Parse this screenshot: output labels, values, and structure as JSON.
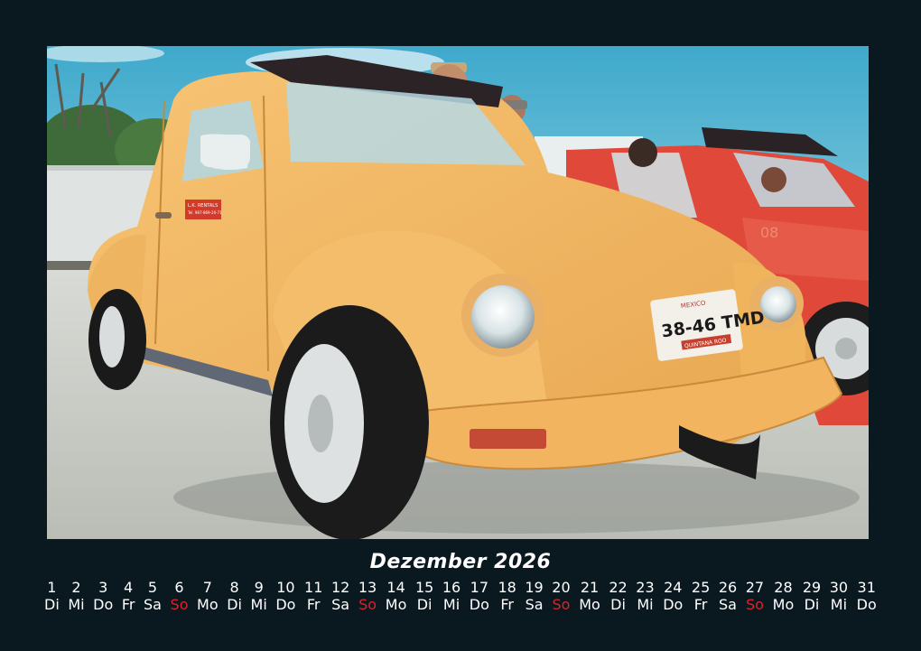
{
  "calendar": {
    "title": "Dezember 2026",
    "days": [
      {
        "num": "1",
        "wd": "Di"
      },
      {
        "num": "2",
        "wd": "Mi"
      },
      {
        "num": "3",
        "wd": "Do"
      },
      {
        "num": "4",
        "wd": "Fr"
      },
      {
        "num": "5",
        "wd": "Sa"
      },
      {
        "num": "6",
        "wd": "So"
      },
      {
        "num": "7",
        "wd": "Mo"
      },
      {
        "num": "8",
        "wd": "Di"
      },
      {
        "num": "9",
        "wd": "Mi"
      },
      {
        "num": "10",
        "wd": "Do"
      },
      {
        "num": "11",
        "wd": "Fr"
      },
      {
        "num": "12",
        "wd": "Sa"
      },
      {
        "num": "13",
        "wd": "So"
      },
      {
        "num": "14",
        "wd": "Mo"
      },
      {
        "num": "15",
        "wd": "Di"
      },
      {
        "num": "16",
        "wd": "Mi"
      },
      {
        "num": "17",
        "wd": "Do"
      },
      {
        "num": "18",
        "wd": "Fr"
      },
      {
        "num": "19",
        "wd": "Sa"
      },
      {
        "num": "20",
        "wd": "So"
      },
      {
        "num": "21",
        "wd": "Mo"
      },
      {
        "num": "22",
        "wd": "Di"
      },
      {
        "num": "23",
        "wd": "Mi"
      },
      {
        "num": "24",
        "wd": "Do"
      },
      {
        "num": "25",
        "wd": "Fr"
      },
      {
        "num": "26",
        "wd": "Sa"
      },
      {
        "num": "27",
        "wd": "So"
      },
      {
        "num": "28",
        "wd": "Mo"
      },
      {
        "num": "29",
        "wd": "Di"
      },
      {
        "num": "30",
        "wd": "Mi"
      },
      {
        "num": "31",
        "wd": "Do"
      }
    ]
  },
  "photo": {
    "plate_country": "MEXICO",
    "plate_number": "38-46 TMD",
    "plate_region": "QUINTANA ROO",
    "door_sign_line1": "L.K. RENTALS",
    "door_sign_line2": "Tel. 987-869-20-71",
    "red_car_number": "08"
  },
  "colors": {
    "frame": "#0a1820",
    "sunday": "#e0202a",
    "car": "#f0b458",
    "sky": "#4fb6d4"
  }
}
